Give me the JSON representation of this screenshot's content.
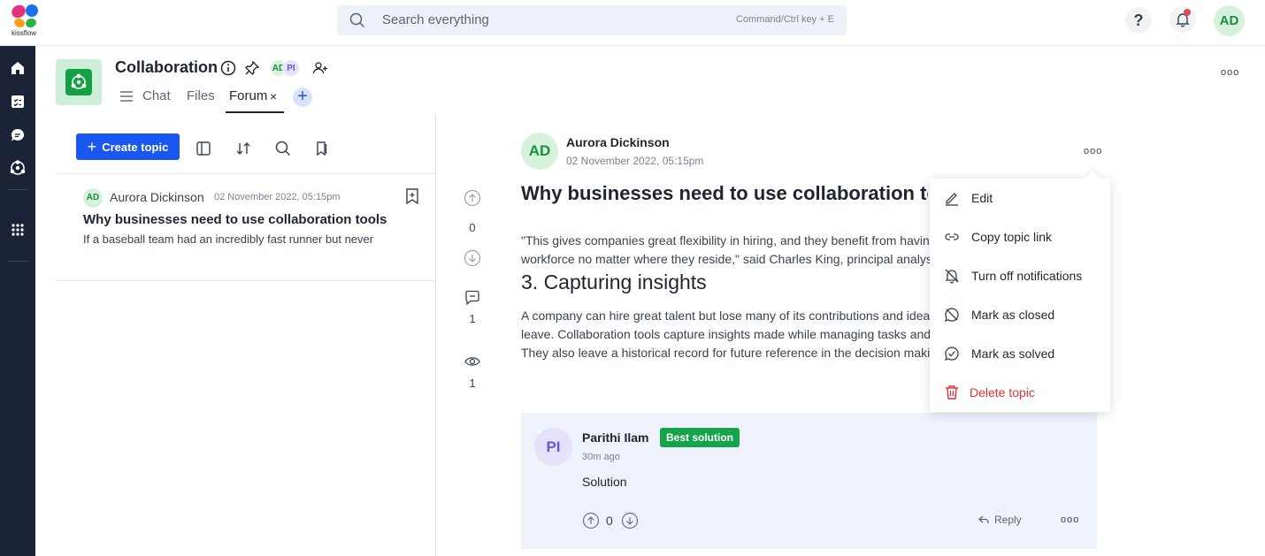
{
  "brand": {
    "name": "kissflow"
  },
  "search": {
    "placeholder": "Search everything",
    "shortcut": "Command/Ctrl key + E"
  },
  "topbar": {
    "help_label": "?",
    "user_initials": "AD"
  },
  "header": {
    "title": "Collaboration",
    "members": [
      "AD",
      "PI"
    ],
    "tabs": [
      {
        "label": "Chat"
      },
      {
        "label": "Files"
      },
      {
        "label": "Forum",
        "close": "×"
      }
    ],
    "add_label": "+"
  },
  "toolbar": {
    "create_label": "Create topic",
    "create_plus": "+"
  },
  "topic_list": [
    {
      "initials": "AD",
      "author": "Aurora Dickinson",
      "date": "02 November 2022, 05:15pm",
      "title": "Why businesses need to use collaboration tools",
      "excerpt": "If a baseball team had an incredibly fast runner but never"
    }
  ],
  "stats": {
    "votes": "0",
    "comments": "1",
    "views": "1"
  },
  "post": {
    "initials": "AD",
    "author": "Aurora Dickinson",
    "date": "02 November 2022, 05:15pm",
    "title": "Why businesses need to use collaboration tools",
    "para1_line1": "\"This gives companies great flexibility in hiring, and they benefit from having access to a",
    "para1_line2": "workforce no matter where they reside,\" said Charles King, principal analyst at Pund-IT.",
    "heading": "3. Capturing insights",
    "para2_line1": "A company can hire great talent but lose many of its contributions and ideas when they",
    "para2_line2": "leave. Collaboration tools capture insights made while managing tasks and projects.",
    "para2_line3": "They also leave a historical record for future reference in the decision making process."
  },
  "reply": {
    "initials": "PI",
    "author": "Parithi Ilam",
    "badge": "Best solution",
    "time": "30m ago",
    "text": "Solution",
    "votes": "0",
    "reply_label": "Reply"
  },
  "menu": {
    "items": [
      {
        "label": "Edit",
        "icon": "pencil-icon"
      },
      {
        "label": "Copy topic link",
        "icon": "link-icon"
      },
      {
        "label": "Turn off notifications",
        "icon": "bell-off-icon"
      },
      {
        "label": "Mark as closed",
        "icon": "closed-icon"
      },
      {
        "label": "Mark as solved",
        "icon": "check-circle-icon"
      },
      {
        "label": "Delete topic",
        "icon": "trash-icon"
      }
    ]
  },
  "colors": {
    "accent": "#1a56f0",
    "rail": "#1b2437",
    "success": "#17a34a",
    "danger": "#e03131"
  }
}
